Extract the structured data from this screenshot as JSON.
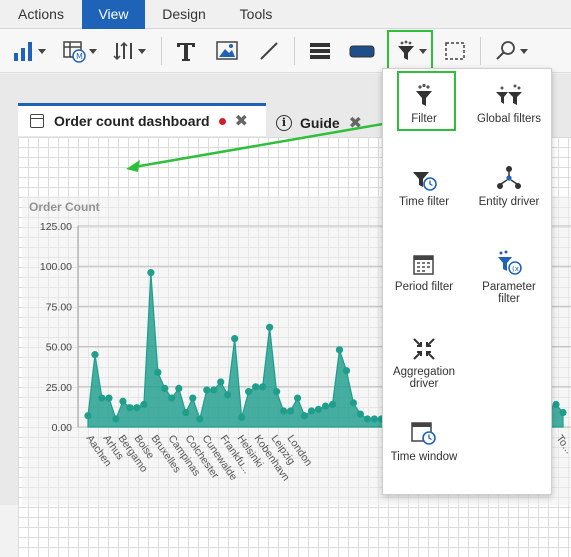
{
  "menubar": {
    "items": [
      {
        "label": "Actions"
      },
      {
        "label": "View",
        "active": true
      },
      {
        "label": "Design"
      },
      {
        "label": "Tools"
      }
    ]
  },
  "toolbar": {
    "icons": [
      "bar-chart-icon",
      "table-icon",
      "sort-icon",
      "text-icon",
      "image-icon",
      "line-icon",
      "rows-icon",
      "rectangle-icon",
      "filter-icon",
      "selection-icon",
      "search-icon"
    ]
  },
  "tabs": [
    {
      "label": "Order count dashboard",
      "modified": true
    },
    {
      "label": "Guide"
    }
  ],
  "dropdown": {
    "items": [
      {
        "label": "Filter",
        "icon": "filter-icon"
      },
      {
        "label": "Global filters",
        "icon": "global-filters-icon"
      },
      {
        "label": "Time filter",
        "icon": "time-filter-icon"
      },
      {
        "label": "Entity driver",
        "icon": "entity-driver-icon"
      },
      {
        "label": "Period filter",
        "icon": "period-filter-icon"
      },
      {
        "label": "Parameter filter",
        "icon": "parameter-filter-icon"
      },
      {
        "label": "Aggregation driver",
        "icon": "aggregation-driver-icon"
      },
      {
        "label": "Time window",
        "icon": "time-window-icon"
      }
    ]
  },
  "colors": {
    "accent": "#1e63b8",
    "highlight": "#2fbf3a",
    "series": "#1f9e8c",
    "modified_dot": "#d0202a"
  },
  "chart_data": {
    "type": "area",
    "title": "Order Count",
    "xlabel": "",
    "ylabel": "",
    "ylim": [
      0,
      125
    ],
    "yticks": [
      "125.00",
      "100.00",
      "75.00",
      "50.00",
      "25.00",
      "0.00"
    ],
    "x_labels_shown": [
      "Aachen",
      "Arhus",
      "Bergamo",
      "Boise",
      "Bruxelles",
      "Campinas",
      "Colchester",
      "Cunewalde",
      "Frankfu...",
      "Helsinki",
      "Kobenhavn",
      "Leipzig",
      "London",
      "...rn",
      "To..."
    ],
    "values": [
      7,
      45,
      18,
      18,
      5,
      16,
      12,
      12,
      14,
      96,
      34,
      24,
      18,
      24,
      9,
      18,
      5,
      23,
      23,
      28,
      20,
      55,
      6,
      22,
      25,
      25,
      62,
      22,
      10,
      10,
      18,
      7,
      10,
      11,
      13,
      14,
      48,
      35,
      15,
      8,
      5,
      5,
      5,
      5,
      5,
      5,
      5,
      5,
      5,
      5,
      5,
      5,
      5,
      5,
      5,
      5,
      5,
      5,
      5,
      5,
      5,
      14,
      10,
      12,
      10,
      8,
      12,
      14,
      9
    ]
  }
}
